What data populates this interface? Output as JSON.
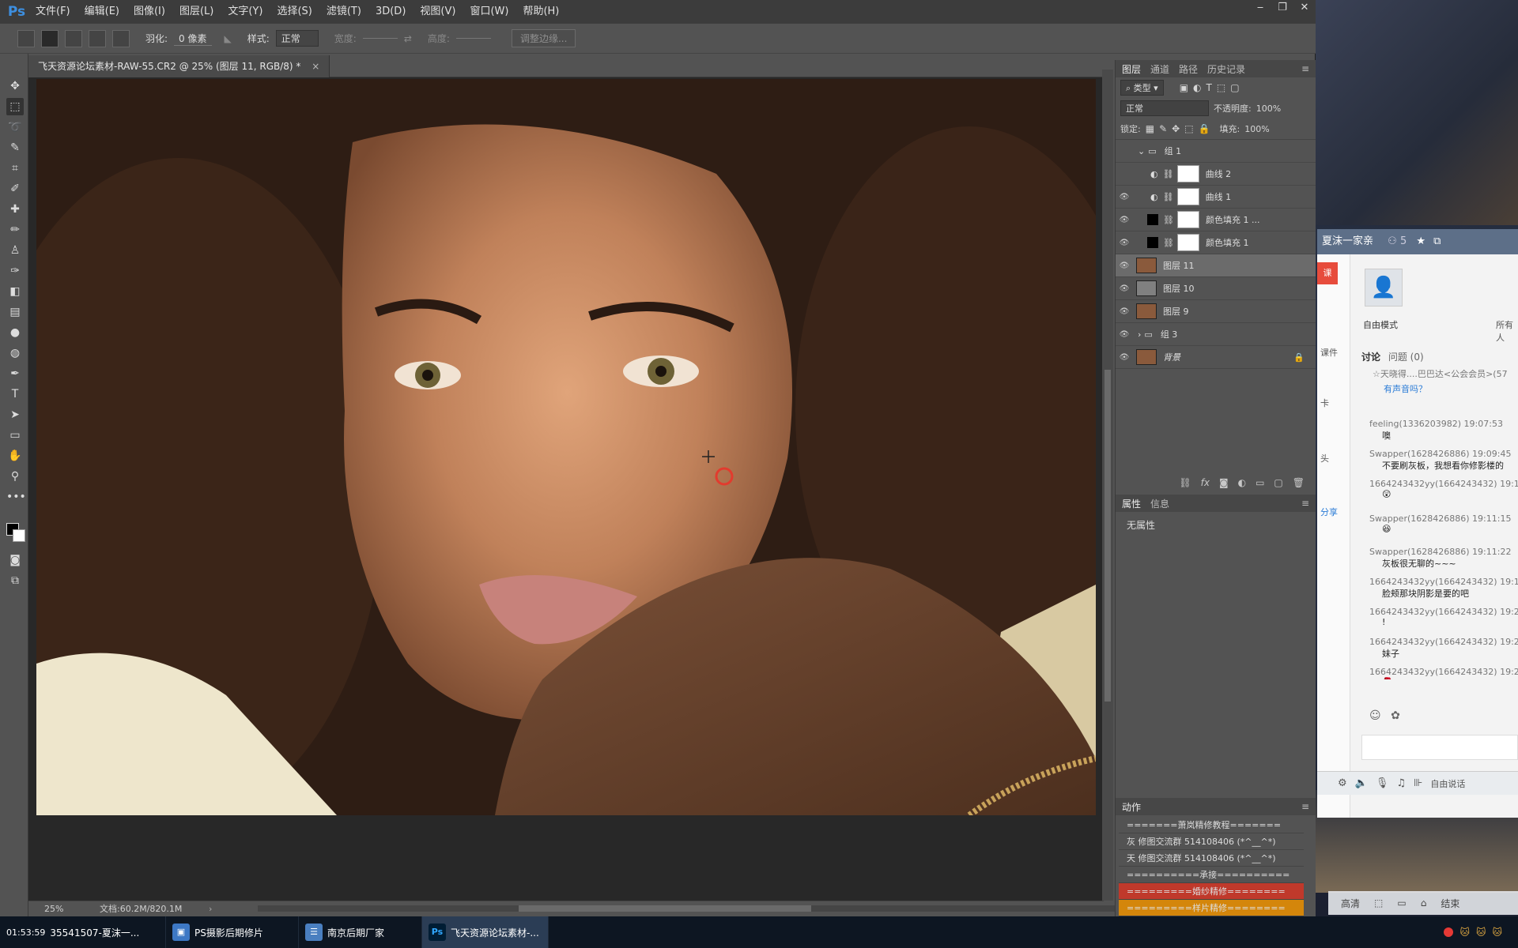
{
  "app": {
    "logo": "Ps",
    "win_minimize": "‒",
    "win_restore": "❐",
    "win_close": "✕"
  },
  "menu": [
    "文件(F)",
    "编辑(E)",
    "图像(I)",
    "图层(L)",
    "文字(Y)",
    "选择(S)",
    "滤镜(T)",
    "3D(D)",
    "视图(V)",
    "窗口(W)",
    "帮助(H)"
  ],
  "options": {
    "feather_label": "羽化:",
    "feather_value": "0 像素",
    "style_label": "样式:",
    "style_value": "正常",
    "width_label": "宽度:",
    "height_label": "高度:",
    "refine_edge": "调整边缘..."
  },
  "document": {
    "tab_title": "飞天资源论坛素材-RAW-55.CR2 @ 25% (图层 11, RGB/8) *",
    "tab_close": "×",
    "zoom": "25%",
    "doc_info": "文档:60.2M/820.1M"
  },
  "layers_panel": {
    "tabs": [
      "图层",
      "通道",
      "路径",
      "历史记录"
    ],
    "filter_kind": "类型",
    "blend_mode": "正常",
    "opacity_label": "不透明度:",
    "opacity_value": "100%",
    "lock_label": "锁定:",
    "fill_label": "填充:",
    "fill_value": "100%",
    "layers": [
      {
        "name": "组 1",
        "type": "group"
      },
      {
        "name": "曲线 2",
        "type": "adjustment"
      },
      {
        "name": "曲线 1",
        "type": "adjustment"
      },
      {
        "name": "颜色填充 1 ...",
        "type": "fill"
      },
      {
        "name": "颜色填充 1",
        "type": "fill"
      },
      {
        "name": "图层 11",
        "type": "image",
        "selected": true
      },
      {
        "name": "图层 10",
        "type": "gray"
      },
      {
        "name": "图层 9",
        "type": "image"
      },
      {
        "name": "组 3",
        "type": "group"
      },
      {
        "name": "背景",
        "type": "background"
      }
    ],
    "footer_icons": [
      "link-icon",
      "fx-icon",
      "mask-icon",
      "adjustment-icon",
      "folder-icon",
      "new-layer-icon",
      "trash-icon"
    ]
  },
  "properties_panel": {
    "tabs": [
      "属性",
      "信息"
    ],
    "content": "无属性"
  },
  "actions_panel": {
    "title": "动作",
    "items": [
      "=======萧岚精修教程=======",
      "灰 修图交流群 514108406 (*^__^*)",
      "天 修图交流群 514108406 (*^__^*)",
      "==========承接==========",
      "=========婚纱精修========",
      "=========样片精修========"
    ]
  },
  "chat": {
    "title": "夏沫一家亲",
    "member_count": "5",
    "mode": "自由模式",
    "mode_right": "所有人",
    "tabs_label": "讨论",
    "question_label": "问题 (0)",
    "side_labels": [
      "课",
      "课件",
      "卡",
      "头",
      "分享"
    ],
    "banner": "☆天晓得....巴巴达<公会会员>(57",
    "banner_link": "有声音吗？",
    "messages": [
      {
        "name": "feeling(1336203982) 19:07:53",
        "text": "噢"
      },
      {
        "name": "Swapper(1628426886) 19:09:45",
        "text": "不要刷灰板，我想看你修影楼的"
      },
      {
        "name": "1664243432yy(1664243432) 19:1",
        "text": "😲"
      },
      {
        "name": "Swapper(1628426886) 19:11:15",
        "text": "😆"
      },
      {
        "name": "Swapper(1628426886) 19:11:22",
        "text": "灰板很无聊的~~~"
      },
      {
        "name": "1664243432yy(1664243432) 19:1",
        "text": "脸颊那块阴影是要的吧"
      },
      {
        "name": "1664243432yy(1664243432) 19:2",
        "text": "!"
      },
      {
        "name": "1664243432yy(1664243432) 19:2",
        "text": "妹子"
      },
      {
        "name": "1664243432yy(1664243432) 19:2",
        "text": "🌹"
      }
    ],
    "toolbar_label": "自由说话",
    "bottom_labels": [
      "高清",
      "结束"
    ]
  },
  "taskbar": {
    "clock": "01:53:59",
    "items": [
      {
        "label": "35541507-夏沫一...",
        "active": false
      },
      {
        "label": "PS摄影后期修片",
        "active": false
      },
      {
        "label": "南京后期厂家",
        "active": false
      },
      {
        "label": "飞天资源论坛素材-...",
        "active": true
      }
    ]
  },
  "colors": {
    "ps_bg": "#535353",
    "selected_action": "#c0392b",
    "action_orange": "#d4860b"
  }
}
